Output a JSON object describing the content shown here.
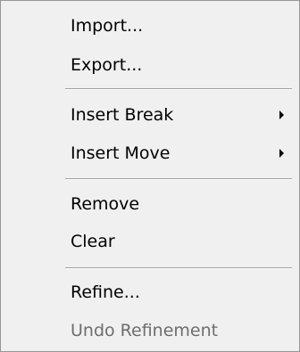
{
  "menu": {
    "items": [
      {
        "label": "Import...",
        "enabled": true,
        "submenu": false
      },
      {
        "label": "Export...",
        "enabled": true,
        "submenu": false
      },
      {
        "label": "Insert Break",
        "enabled": true,
        "submenu": true
      },
      {
        "label": "Insert Move",
        "enabled": true,
        "submenu": true
      },
      {
        "label": "Remove",
        "enabled": true,
        "submenu": false
      },
      {
        "label": "Clear",
        "enabled": true,
        "submenu": false
      },
      {
        "label": "Refine...",
        "enabled": true,
        "submenu": false
      },
      {
        "label": "Undo Refinement",
        "enabled": false,
        "submenu": false
      }
    ],
    "submenu_arrow_icon": "triangle-right-icon",
    "colors": {
      "background": "#f0f0f0",
      "border": "#979797",
      "text": "#000000",
      "disabled_text": "#6d6d6d",
      "separator": "#a0a0a0"
    }
  }
}
